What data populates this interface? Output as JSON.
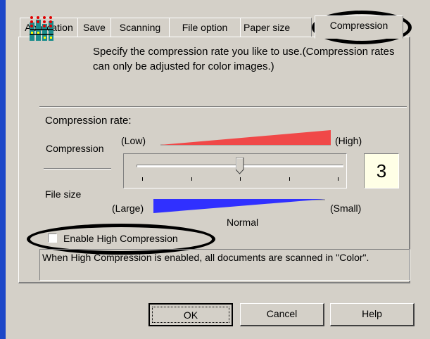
{
  "tabs": [
    {
      "label": "Application"
    },
    {
      "label": "Save"
    },
    {
      "label": "Scanning"
    },
    {
      "label": "File option"
    },
    {
      "label": "Paper size"
    },
    {
      "label": "Compression",
      "active": true
    }
  ],
  "intro": {
    "icon": "compression-bars-icon",
    "text": "Specify the compression rate you like to use.(Compression rates can only be adjusted for color images.)"
  },
  "compression": {
    "section_label": "Compression rate:",
    "compression_label": "Compression",
    "low_label": "(Low)",
    "high_label": "(High)",
    "file_size_label": "File size",
    "large_label": "(Large)",
    "small_label": "(Small)",
    "normal_label": "Normal",
    "value": "3",
    "slider_min": 1,
    "slider_max": 5,
    "slider_value": 3,
    "compression_color": "#f04848",
    "file_size_color": "#3030ff"
  },
  "high_compression": {
    "label": "Enable High Compression",
    "checked": false
  },
  "note": "When High Compression is enabled, all documents are scanned in \"Color\".",
  "buttons": {
    "ok": "OK",
    "cancel": "Cancel",
    "help": "Help"
  }
}
